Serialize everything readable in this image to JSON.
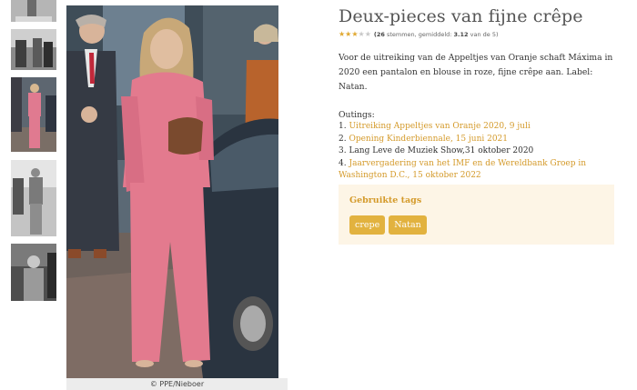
{
  "gallery": {
    "thumbnails": [
      {
        "label": "outfit photo thumbnail 1",
        "tone": "#9a9a9a"
      },
      {
        "label": "outfit photo thumbnail 2",
        "tone": "#7d7d7d"
      },
      {
        "label": "outfit photo thumbnail 3",
        "tone": "#c9a0a8"
      },
      {
        "label": "outfit photo thumbnail 4",
        "tone": "#a8a8a8"
      },
      {
        "label": "outfit photo thumbnail 5",
        "tone": "#8e8e8e"
      }
    ],
    "main_photo_credit": "© PPE/Nieboer",
    "colors": {
      "outfit_pink": "#e37a8e",
      "background_dark": "#4a5560",
      "pavement": "#7a6a62"
    }
  },
  "article": {
    "title": "Deux-pieces van fijne crêpe",
    "rating": {
      "stars_filled": 3,
      "stars_total": 5,
      "votes_text": "(26",
      "votes_label": " stemmen, gemiddeld: ",
      "average": "3.12",
      "out_of": " van de 5)"
    },
    "description": "Voor de uitreiking van de Appeltjes van Oranje schaft Máxima in 2020 een pantalon en blouse in roze, fijne crêpe aan. Label: Natan.",
    "outings_title": "Outings:",
    "outings": [
      {
        "num": "1.",
        "text": "Uitreiking Appeltjes van Oranje 2020, 9 juli",
        "link": true
      },
      {
        "num": "2.",
        "text": "Opening Kinderbiennale, 15 juni 2021",
        "link": true
      },
      {
        "num": "3.",
        "text": "Lang Leve de Muziek Show,31 oktober 2020",
        "link": false
      },
      {
        "num": "4.",
        "text": "Jaarvergadering van het IMF en de Wereldbank Groep in Washington D.C., 15 oktober 2022",
        "link": true
      }
    ]
  },
  "tags_box": {
    "title": "Gebruikte tags",
    "tags": [
      "crepe",
      "Natan"
    ],
    "accent": "#e2b23f",
    "background": "#fdf5e6"
  }
}
